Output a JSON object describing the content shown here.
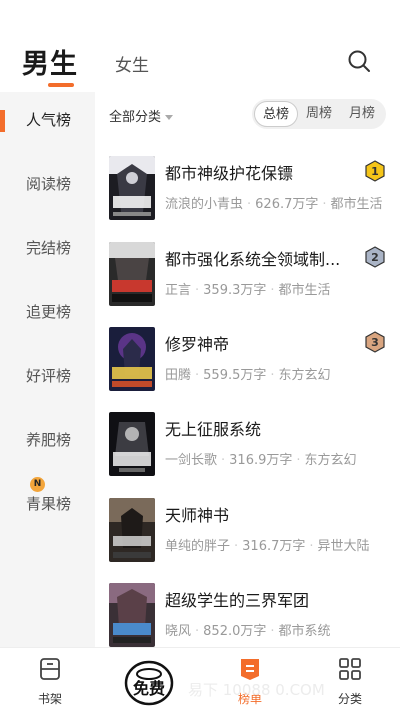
{
  "header": {
    "tab_male": "男生",
    "tab_female": "女生",
    "accent_color": "#f36d2b"
  },
  "sidebar": {
    "items": [
      {
        "label": "人气榜",
        "active": true
      },
      {
        "label": "阅读榜"
      },
      {
        "label": "完结榜"
      },
      {
        "label": "追更榜"
      },
      {
        "label": "好评榜"
      },
      {
        "label": "养肥榜"
      },
      {
        "label": "青果榜",
        "badge": "N"
      }
    ]
  },
  "main": {
    "filter_label": "全部分类",
    "segments": [
      {
        "label": "总榜",
        "active": true
      },
      {
        "label": "周榜"
      },
      {
        "label": "月榜"
      }
    ],
    "books": [
      {
        "title": "都市神级护花保镖",
        "author": "流浪的小青虫",
        "words": "626.7万字",
        "category": "都市生活",
        "rank": "1",
        "rank_color": "#f5c518"
      },
      {
        "title": "都市强化系统全领域制...",
        "author": "正言",
        "words": "359.3万字",
        "category": "都市生活",
        "rank": "2",
        "rank_color": "#aab4c6"
      },
      {
        "title": "修罗神帝",
        "author": "田腾",
        "words": "559.5万字",
        "category": "东方玄幻",
        "rank": "3",
        "rank_color": "#d9a580"
      },
      {
        "title": "无上征服系统",
        "author": "一剑长歌",
        "words": "316.9万字",
        "category": "东方玄幻"
      },
      {
        "title": "天师神书",
        "author": "单纯的胖子",
        "words": "316.7万字",
        "category": "异世大陆"
      },
      {
        "title": "超级学生的三界军团",
        "author": "晓风",
        "words": "852.0万字",
        "category": "都市系统"
      }
    ]
  },
  "bottom_nav": {
    "bookshelf": "书架",
    "ranking": "榜单",
    "category": "分类",
    "logo_text": "免费",
    "watermark": "易下    10088     0.COM"
  }
}
